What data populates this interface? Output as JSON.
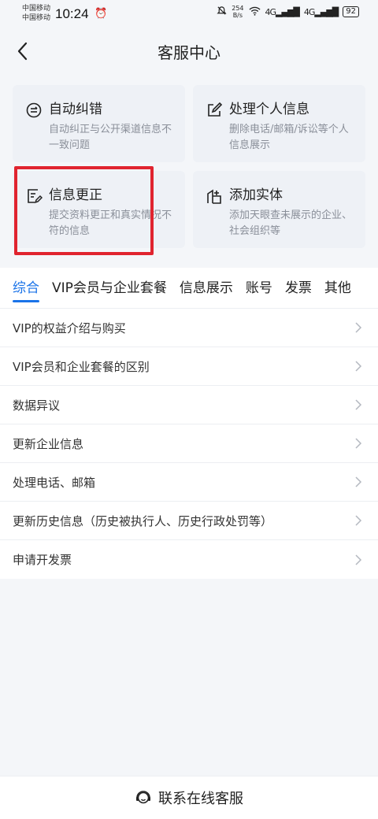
{
  "status_bar": {
    "carrier_1": "中国移动",
    "carrier_2": "中国移动",
    "time": "10:24",
    "net_speed_value": "254",
    "net_speed_unit": "B/s",
    "signal_1": "4G",
    "signal_2": "4G",
    "battery": "92"
  },
  "header": {
    "title": "客服中心"
  },
  "cards": [
    {
      "title": "自动纠错",
      "desc": "自动纠正与公开渠道信息不一致问题",
      "icon": "auto-correct-icon"
    },
    {
      "title": "处理个人信息",
      "desc": "删除电话/邮箱/诉讼等个人信息展示",
      "icon": "edit-icon"
    },
    {
      "title": "信息更正",
      "desc": "提交资料更正和真实情况不符的信息",
      "icon": "document-edit-icon"
    },
    {
      "title": "添加实体",
      "desc": "添加天眼查未展示的企业、社会组织等",
      "icon": "add-building-icon"
    }
  ],
  "highlight_color": "#e0242f",
  "accent_color": "#1a73e8",
  "tabs": [
    "综合",
    "VIP会员与企业套餐",
    "信息展示",
    "账号",
    "发票",
    "其他"
  ],
  "active_tab": "综合",
  "list": [
    "VIP的权益介绍与购买",
    "VIP会员和企业套餐的区别",
    "数据异议",
    "更新企业信息",
    "处理电话、邮箱",
    "更新历史信息（历史被执行人、历史行政处罚等）",
    "申请开发票"
  ],
  "bottom": {
    "label": "联系在线客服",
    "icon": "customer-service-icon"
  }
}
